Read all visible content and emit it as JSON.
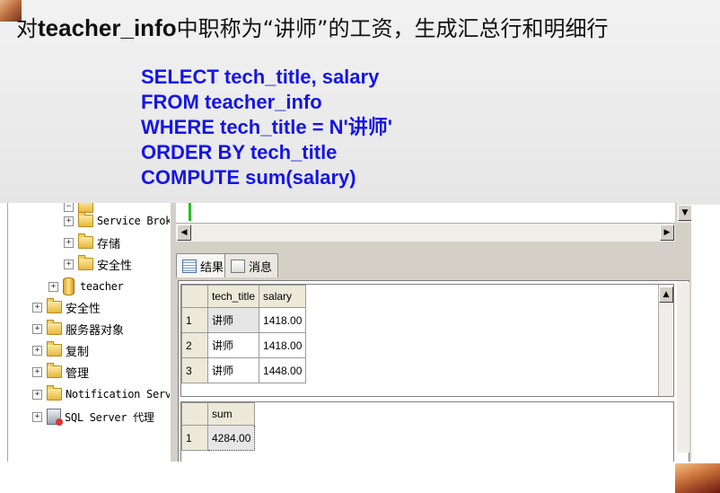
{
  "slide": {
    "heading_prefix": "对",
    "heading_keyword": "teacher_info",
    "heading_suffix": "中职称为“讲师”的工资，生成汇总行和明细行",
    "sql_lines": [
      "SELECT tech_title, salary",
      "FROM teacher_info",
      "WHERE tech_title = N'讲师'",
      "ORDER BY tech_title",
      "COMPUTE sum(salary)"
    ],
    "sql_color": "#1515e6"
  },
  "tree": {
    "items": [
      {
        "label": "Service Broker",
        "icon": "folder-icon",
        "expander": "+"
      },
      {
        "label": "存储",
        "icon": "folder-icon",
        "expander": "+"
      },
      {
        "label": "安全性",
        "icon": "folder-icon",
        "expander": "+"
      },
      {
        "label": "teacher",
        "icon": "database-icon",
        "expander": "+"
      },
      {
        "label": "安全性",
        "icon": "folder-icon",
        "expander": "+"
      },
      {
        "label": "服务器对象",
        "icon": "folder-icon",
        "expander": "+"
      },
      {
        "label": "复制",
        "icon": "folder-icon",
        "expander": "+"
      },
      {
        "label": "管理",
        "icon": "folder-icon",
        "expander": "+"
      },
      {
        "label": "Notification Services",
        "icon": "folder-icon",
        "expander": "+"
      },
      {
        "label": "SQL Server 代理",
        "icon": "agent-icon",
        "expander": "+"
      }
    ]
  },
  "results": {
    "tabs": [
      {
        "label": "结果",
        "icon": "grid-icon",
        "active": true
      },
      {
        "label": "消息",
        "icon": "message-icon",
        "active": false
      }
    ],
    "grid1": {
      "columns": [
        "tech_title",
        "salary"
      ],
      "rows": [
        {
          "num": "1",
          "tech_title": "讲师",
          "salary": "1418.00"
        },
        {
          "num": "2",
          "tech_title": "讲师",
          "salary": "1418.00"
        },
        {
          "num": "3",
          "tech_title": "讲师",
          "salary": "1448.00"
        }
      ]
    },
    "grid2": {
      "columns": [
        "sum"
      ],
      "rows": [
        {
          "num": "1",
          "sum": "4284.00"
        }
      ]
    }
  }
}
